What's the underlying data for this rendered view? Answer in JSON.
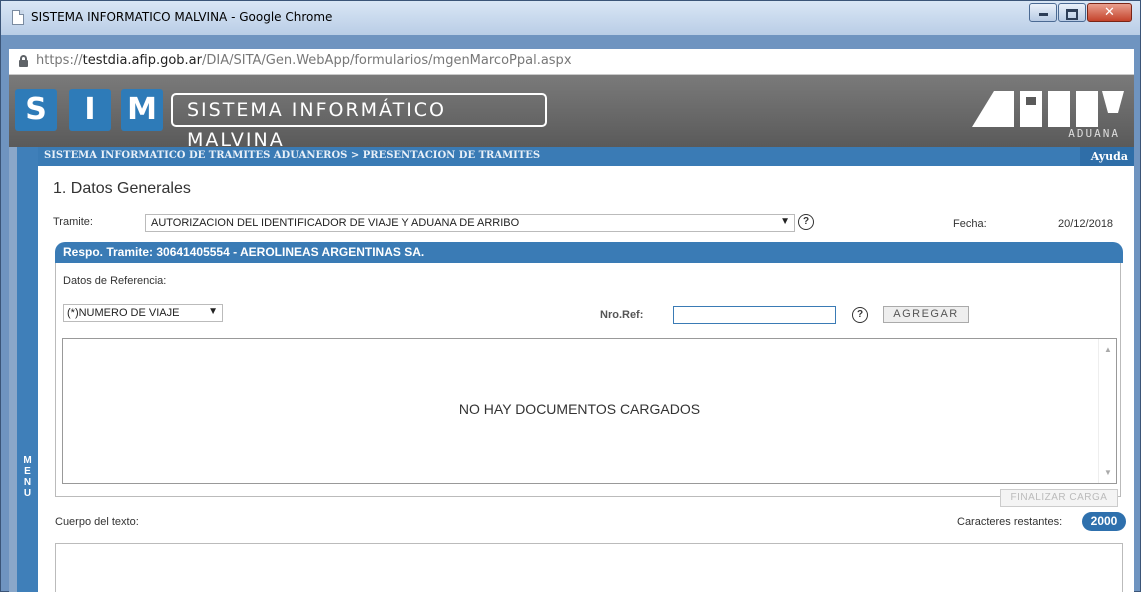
{
  "window": {
    "title": "SISTEMA INFORMATICO MALVINA - Google Chrome",
    "url_prefix": "https://",
    "url_host": "testdia.afip.gob.ar",
    "url_path": "/DIA/SITA/Gen.WebApp/formularios/mgenMarcoPpal.aspx",
    "buttons": {
      "minimize": "minimize-icon",
      "maximize": "maximize-icon",
      "close": "close-icon"
    }
  },
  "header": {
    "sim_letters": [
      "S",
      "I",
      "M"
    ],
    "title": "SISTEMA INFORMÁTICO MALVINA",
    "logo": "AFIP",
    "logo_subtitle": "ADUANA"
  },
  "breadcrumb": {
    "text": "SISTEMA INFORMATICO DE TRAMITES ADUANEROS > PRESENTACION DE TRAMITES",
    "help": "Ayuda"
  },
  "menu": {
    "label": "MENU"
  },
  "form": {
    "section_title": "1. Datos Generales",
    "tramite_label": "Tramite:",
    "tramite_value": "AUTORIZACION DEL IDENTIFICADOR DE VIAJE Y ADUANA DE ARRIBO",
    "fecha_label": "Fecha:",
    "fecha_value": "20/12/2018",
    "resp_tramite": "Respo. Tramite: 30641405554 - AEROLINEAS ARGENTINAS SA.",
    "ref_title": "Datos de Referencia:",
    "ref_type": "(*)NUMERO DE VIAJE",
    "nro_ref_label": "Nro.Ref:",
    "nro_ref_value": "",
    "agregar": "AGREGAR",
    "empty_docs": "NO HAY DOCUMENTOS CARGADOS",
    "finalizar": "FINALIZAR CARGA",
    "cuerpo_label": "Cuerpo del texto:",
    "caracteres_label": "Caracteres restantes:",
    "caracteres_count": "2000",
    "help_glyph": "?"
  },
  "colors": {
    "accent": "#3a7bb5",
    "header_bg": "#6a6a6a",
    "sim_blue": "#2e7bb8"
  }
}
